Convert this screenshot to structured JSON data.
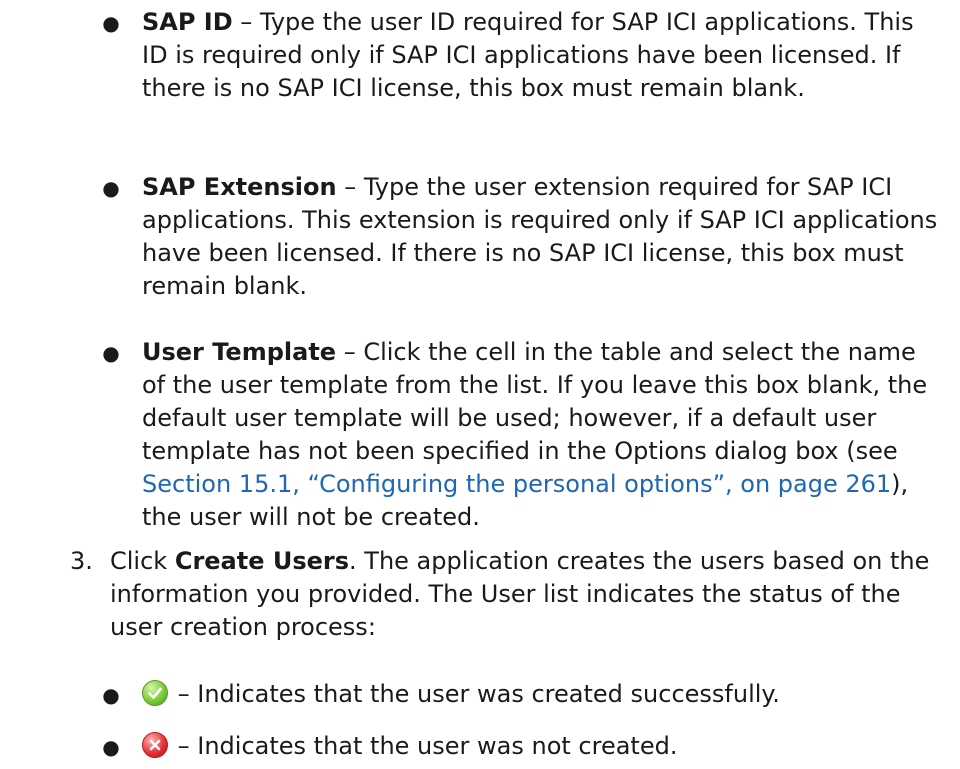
{
  "bullets": [
    {
      "term": "SAP ID",
      "text": " – Type the user ID required for SAP ICI applications. This ID is required only if SAP ICI applications have been licensed. If there is no SAP ICI license, this box must remain blank."
    },
    {
      "term": "SAP Extension",
      "text": " – Type the user extension required for SAP ICI applications. This extension is required only if SAP ICI applications have been licensed. If there is no SAP ICI license, this box must remain blank."
    },
    {
      "term": "User Template",
      "text_before": " – Click the cell in the table and select the name of the user template from the list. If you leave this box blank, the default user template will be used; however, if a default user template has not been specified in the Options dialog box (see ",
      "link": "Section 15.1, “Configuring the personal options”, on page 261",
      "text_after": "), the user will not be created."
    }
  ],
  "step3": {
    "number": "3.",
    "prefix": "Click ",
    "action": "Create Users",
    "text": ". The application creates the users based on the information you provided. The User list indicates the status of the user creation process:"
  },
  "status": [
    {
      "icon": "check-success-icon",
      "text": " – Indicates that the user was created successfully."
    },
    {
      "icon": "x-error-icon",
      "text": " – Indicates that the user was not created."
    }
  ],
  "colors": {
    "link": "#1f66b5",
    "text": "#1a1a1a"
  }
}
